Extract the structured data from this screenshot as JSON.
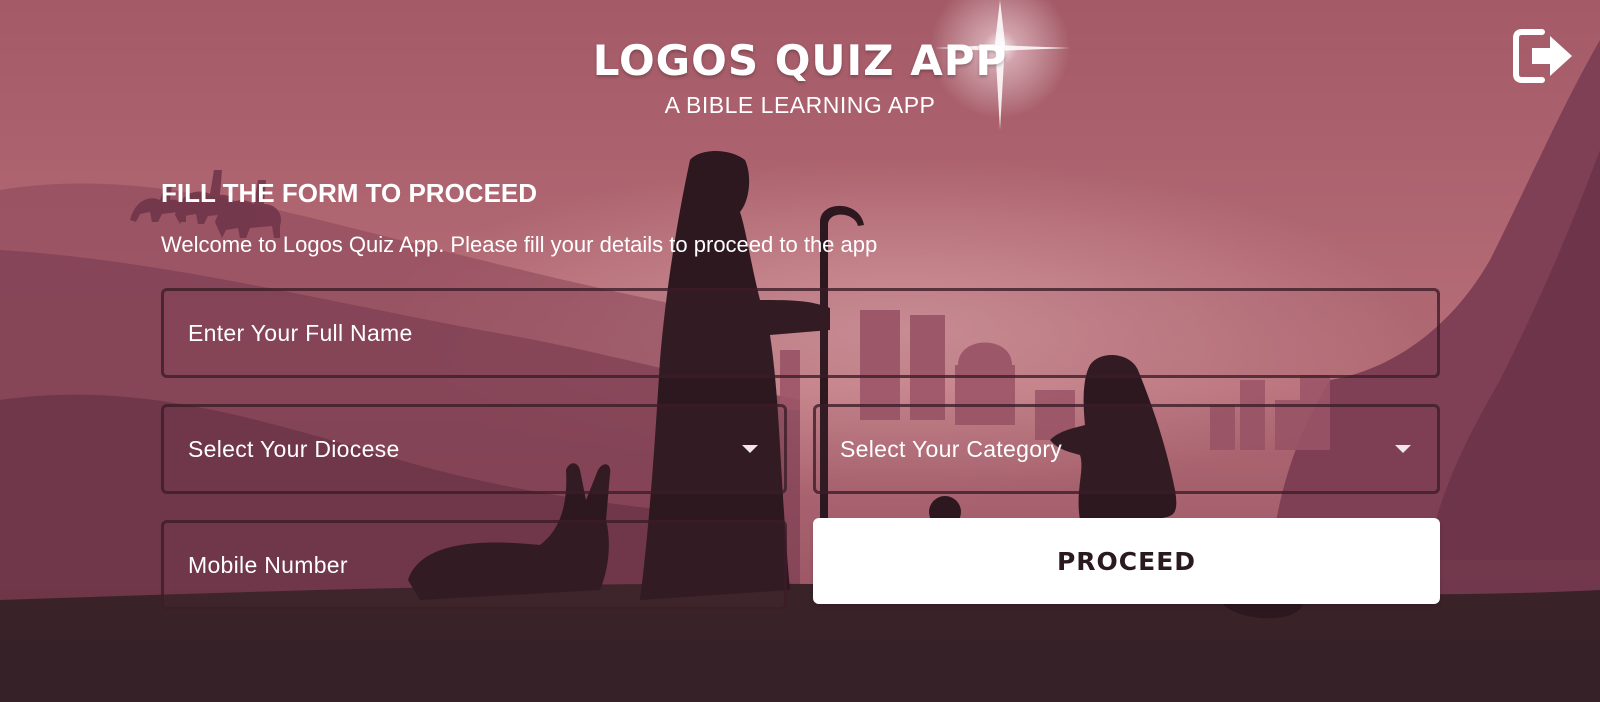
{
  "header": {
    "title": "LOGOS QUIZ APP",
    "subtitle": "A BIBLE LEARNING APP",
    "exit_icon": "logout-icon"
  },
  "form": {
    "heading": "FILL THE FORM TO PROCEED",
    "intro": "Welcome to Logos Quiz App. Please fill your details to proceed to the app",
    "full_name": {
      "placeholder": "Enter Your Full Name",
      "value": ""
    },
    "diocese": {
      "placeholder": "Select Your Diocese",
      "value": "",
      "icon": "chevron-down-icon"
    },
    "category": {
      "placeholder": "Select Your Category",
      "value": "",
      "icon": "chevron-down-icon"
    },
    "mobile": {
      "placeholder": "Mobile Number",
      "value": ""
    },
    "proceed_label": "PROCEED"
  },
  "colors": {
    "background": "#9a5363",
    "silhouette": "#2e1820",
    "button_bg": "#ffffff",
    "text": "#ffffff"
  }
}
